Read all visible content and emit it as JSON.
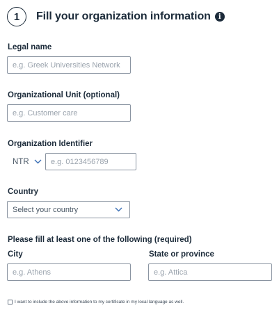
{
  "header": {
    "step_number": "1",
    "title": "Fill your organization information",
    "info_icon": "i"
  },
  "form": {
    "legal_name": {
      "label": "Legal name",
      "placeholder": "e.g. Greek Universities Network"
    },
    "org_unit": {
      "label": "Organizational Unit (optional)",
      "placeholder": "e.g. Customer care"
    },
    "org_identifier": {
      "label": "Organization Identifier",
      "type_selected": "NTR",
      "placeholder": "e.g. 0123456789"
    },
    "country": {
      "label": "Country",
      "selected": "Select your country"
    },
    "required_note": "Please fill at least one of the following (required)",
    "city": {
      "label": "City",
      "placeholder": "e.g. Athens"
    },
    "state": {
      "label": "State or province",
      "placeholder": "e.g. Attica"
    },
    "local_language_checkbox": {
      "label": "I want to include the above information to my certificate in my local language as well.",
      "checked": false
    }
  },
  "colors": {
    "text": "#1c2b3a",
    "border": "#8a94a1",
    "placeholder": "#9aa3ad",
    "accent": "#3a6fb5"
  },
  "icons": [
    "step-number-circle",
    "info-icon",
    "chevron-down-icon"
  ]
}
